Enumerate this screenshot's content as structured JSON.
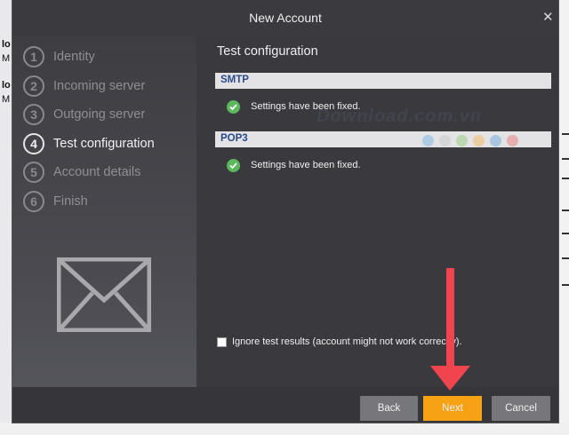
{
  "window": {
    "title": "New Account",
    "close_glyph": "✕"
  },
  "background": {
    "left_items": [
      {
        "title": "lo",
        "sub": "M"
      },
      {
        "title": "lo",
        "sub": "M"
      }
    ]
  },
  "steps": [
    {
      "number": "1",
      "label": "Identity"
    },
    {
      "number": "2",
      "label": "Incoming server"
    },
    {
      "number": "3",
      "label": "Outgoing server"
    },
    {
      "number": "4",
      "label": "Test configuration",
      "active": true
    },
    {
      "number": "5",
      "label": "Account details"
    },
    {
      "number": "6",
      "label": "Finish"
    }
  ],
  "main": {
    "heading": "Test configuration",
    "sections": [
      {
        "name": "SMTP",
        "status": "Settings have been fixed."
      },
      {
        "name": "POP3",
        "status": "Settings have been fixed."
      }
    ],
    "ignore_checkbox": {
      "label": "Ignore test results (account might not work correctly).",
      "checked": false
    },
    "watermark": "Download.com.vn"
  },
  "buttons": {
    "back": "Back",
    "next": "Next",
    "cancel": "Cancel"
  },
  "colors": {
    "accent": "#f7a114",
    "success": "#5cb85c",
    "annotation_arrow": "#f0454f",
    "dialog_bg": "#3b3b40",
    "section_header_text": "#2a4a88"
  },
  "icons": {
    "sidebar_illustration": "envelope-icon",
    "status": "check-circle-icon",
    "annotation": "red-down-arrow"
  }
}
